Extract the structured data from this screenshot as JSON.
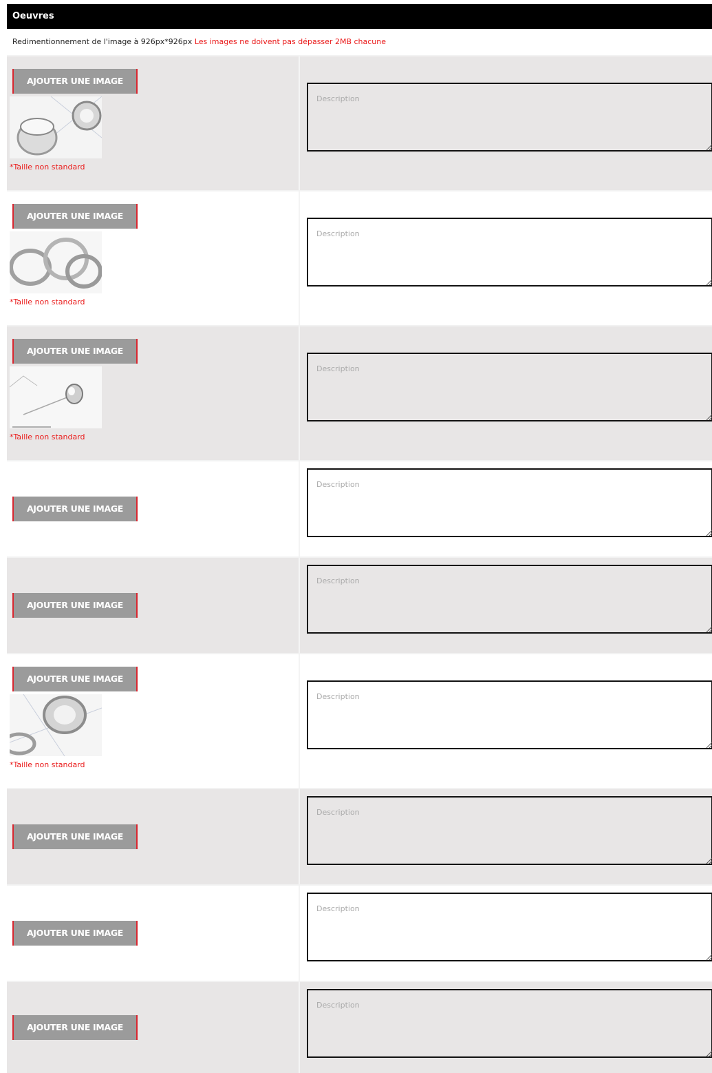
{
  "section": {
    "title": "Oeuvres",
    "resize_text": "Redimentionnement de l'image à 926px*926px",
    "size_warning": "Les images ne doivent pas dépasser 2MB chacune"
  },
  "colors": {
    "header_bg": "#000000",
    "warning_red": "#ea1a1a",
    "button_grey": "#9b9b9b",
    "button_border_red": "#d8262f",
    "row_grey": "#e8e6e6"
  },
  "rows": [
    {
      "button_label": "AJOUTER UNE IMAGE",
      "has_image": true,
      "image_icon": "jewelry-ring-thumbnail",
      "note": "*Taille non standard",
      "description_placeholder": "Description"
    },
    {
      "button_label": "AJOUTER UNE IMAGE",
      "has_image": true,
      "image_icon": "jewelry-rings-thumbnail",
      "note": "*Taille non standard",
      "description_placeholder": "Description"
    },
    {
      "button_label": "AJOUTER UNE IMAGE",
      "has_image": true,
      "image_icon": "jewelry-pendant-thumbnail",
      "note": "*Taille non standard",
      "description_placeholder": "Description"
    },
    {
      "button_label": "AJOUTER UNE IMAGE",
      "has_image": false,
      "description_placeholder": "Description"
    },
    {
      "button_label": "AJOUTER UNE IMAGE",
      "has_image": false,
      "description_placeholder": "Description"
    },
    {
      "button_label": "AJOUTER UNE IMAGE",
      "has_image": true,
      "image_icon": "jewelry-ring-thumbnail",
      "note": "*Taille non standard",
      "description_placeholder": "Description"
    },
    {
      "button_label": "AJOUTER UNE IMAGE",
      "has_image": false,
      "description_placeholder": "Description"
    },
    {
      "button_label": "AJOUTER UNE IMAGE",
      "has_image": false,
      "description_placeholder": "Description"
    },
    {
      "button_label": "AJOUTER UNE IMAGE",
      "has_image": false,
      "description_placeholder": "Description"
    }
  ]
}
